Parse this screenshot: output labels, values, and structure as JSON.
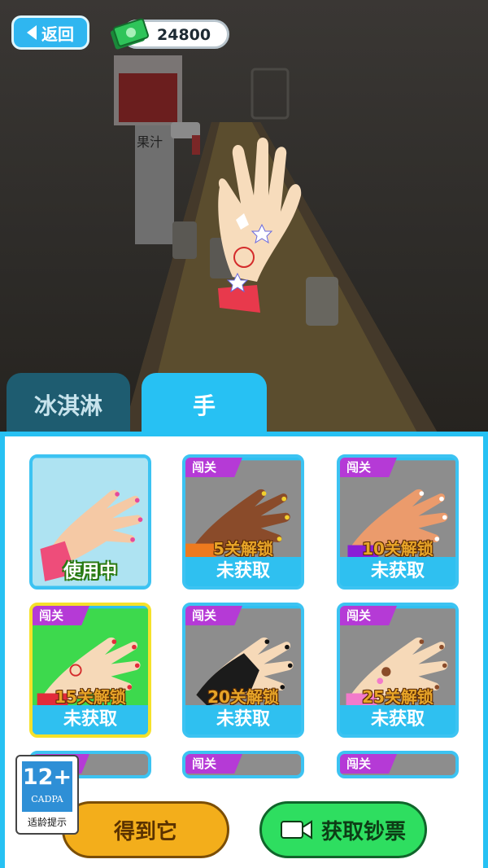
{
  "header": {
    "back_label": "返回",
    "coins": "24800"
  },
  "scene": {
    "machine_label": "果汁"
  },
  "tabs": [
    {
      "label": "冰淇淋"
    },
    {
      "label": "手"
    }
  ],
  "cards": [
    {
      "badge": "",
      "lock": "",
      "status": "使用中"
    },
    {
      "badge": "闯关",
      "lock": "5关解锁",
      "status": "未获取"
    },
    {
      "badge": "闯关",
      "lock": "10关解锁",
      "status": "未获取"
    },
    {
      "badge": "闯关",
      "lock": "15关解锁",
      "status": "未获取"
    },
    {
      "badge": "闯关",
      "lock": "20关解锁",
      "status": "未获取"
    },
    {
      "badge": "闯关",
      "lock": "25关解锁",
      "status": "未获取"
    },
    {
      "badge": "闯关"
    },
    {
      "badge": "闯关"
    },
    {
      "badge": "闯关"
    }
  ],
  "buttons": {
    "get_label": "得到它",
    "cash_label": "获取钞票"
  },
  "age_rating": {
    "number": "12+",
    "org": "CADPA",
    "tip": "适龄提示"
  },
  "colors": {
    "accent": "#27c1f3",
    "lock_badge": "#b53ad6",
    "get_button": "#f3ae1b",
    "cash_button": "#2ede60"
  }
}
